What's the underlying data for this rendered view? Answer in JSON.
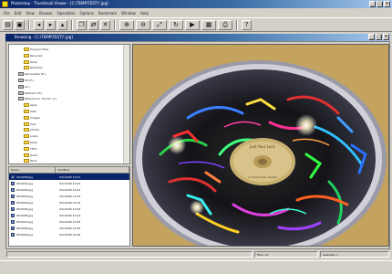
{
  "app": {
    "title": "Photoshop - Thumbnail Viewer - [C:\\TEMP\\TEST\\*.jpg]"
  },
  "menu": {
    "items": [
      "File",
      "Edit",
      "View",
      "Browse",
      "Operation",
      "Options",
      "Bookmark",
      "Window",
      "Help"
    ]
  },
  "child": {
    "title": "Browsing - [C:\\TEMP\\TEST\\*.jpg]"
  },
  "tree": {
    "items": [
      {
        "label": "Program Files",
        "indent": 2,
        "kind": "folder"
      },
      {
        "label": "Recycled",
        "indent": 2,
        "kind": "folder"
      },
      {
        "label": "temp",
        "indent": 2,
        "kind": "folder"
      },
      {
        "label": "Windows",
        "indent": 2,
        "kind": "folder"
      },
      {
        "label": "Removable (E:)",
        "indent": 1,
        "kind": "drive"
      },
      {
        "label": "CD (F:)",
        "indent": 1,
        "kind": "drive"
      },
      {
        "label": "(G:)",
        "indent": 1,
        "kind": "drive"
      },
      {
        "label": "Network (H:)",
        "indent": 1,
        "kind": "drive"
      },
      {
        "label": "Network on 'Server' (I:)",
        "indent": 1,
        "kind": "drive"
      },
      {
        "label": "Apps",
        "indent": 2,
        "kind": "folder"
      },
      {
        "label": "data",
        "indent": 2,
        "kind": "folder"
      },
      {
        "label": "Images",
        "indent": 2,
        "kind": "folder"
      },
      {
        "label": "misc",
        "indent": 2,
        "kind": "folder"
      },
      {
        "label": "photos",
        "indent": 2,
        "kind": "folder"
      },
      {
        "label": "scans",
        "indent": 2,
        "kind": "folder"
      },
      {
        "label": "temp",
        "indent": 2,
        "kind": "folder"
      },
      {
        "label": "TEST",
        "indent": 2,
        "kind": "folder"
      },
      {
        "label": "Users",
        "indent": 2,
        "kind": "folder"
      },
      {
        "label": "Work",
        "indent": 2,
        "kind": "folder"
      }
    ]
  },
  "filelist": {
    "headers": [
      "Name",
      "Modified"
    ],
    "rows": [
      {
        "name": "CD-ROM.jpg",
        "date": "02/10/99 10:21",
        "selected": true
      },
      {
        "name": "PIC0001.jpg",
        "date": "02/10/99 10:22",
        "selected": false
      },
      {
        "name": "PIC0002.jpg",
        "date": "02/10/99 10:22",
        "selected": false
      },
      {
        "name": "PIC0003.jpg",
        "date": "02/10/99 10:23",
        "selected": false
      },
      {
        "name": "PIC0004.jpg",
        "date": "02/10/99 10:23",
        "selected": false
      },
      {
        "name": "PIC0005.jpg",
        "date": "02/10/99 10:24",
        "selected": false
      },
      {
        "name": "PIC0006.jpg",
        "date": "02/10/99 10:24",
        "selected": false
      },
      {
        "name": "PIC0007.jpg",
        "date": "02/10/99 10:25",
        "selected": false
      },
      {
        "name": "PIC0008.jpg",
        "date": "02/10/99 10:25",
        "selected": false
      },
      {
        "name": "PIC0009.jpg",
        "date": "02/10/99 10:26",
        "selected": false
      }
    ]
  },
  "viewer": {
    "disc_label_line1": "Just Your Luck",
    "disc_label_line2": "Compact Disc Digital"
  },
  "statusbar": {
    "panels": [
      "",
      "Files: 10",
      "Selected: 1"
    ]
  },
  "colors": {
    "title_active": "#0a246a",
    "viewer_bg": "#c9a863",
    "selection": "#0a246a"
  }
}
